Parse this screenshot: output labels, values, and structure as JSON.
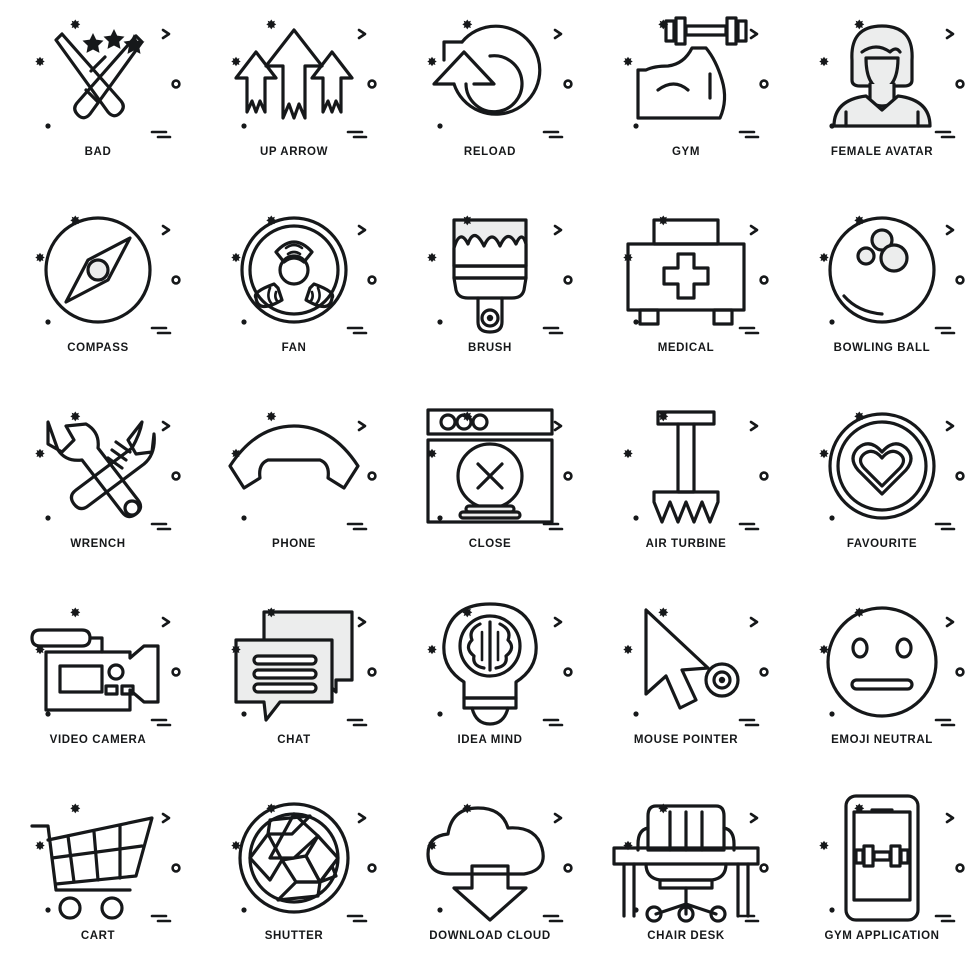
{
  "sheet": {
    "title": "Icon Set Sheet",
    "columns": 5,
    "rows": 5,
    "style": "line art / outline icons",
    "stroke_color": "#16181a",
    "fill_color": "#eceded",
    "background_color": "#ffffff"
  },
  "icons": [
    {
      "id": "bad",
      "label": "BAD",
      "glyph": "crossed-cricket-bats-with-stars"
    },
    {
      "id": "up-arrow",
      "label": "UP ARROW",
      "glyph": "three-upward-arrows"
    },
    {
      "id": "reload",
      "label": "RELOAD",
      "glyph": "circular-refresh-arrow"
    },
    {
      "id": "gym",
      "label": "GYM",
      "glyph": "flexed-arm-with-dumbbell"
    },
    {
      "id": "female-avatar",
      "label": "FEMALE AVATAR",
      "glyph": "woman-bust-portrait"
    },
    {
      "id": "compass",
      "label": "COMPASS",
      "glyph": "compass-needle-in-circle"
    },
    {
      "id": "fan",
      "label": "FAN",
      "glyph": "three-blade-fan-in-circle"
    },
    {
      "id": "brush",
      "label": "BRUSH",
      "glyph": "paint-brush-with-paint"
    },
    {
      "id": "medical",
      "label": "MEDICAL",
      "glyph": "first-aid-kit-with-cross"
    },
    {
      "id": "bowling-ball",
      "label": "BOWLING BALL",
      "glyph": "bowling-ball-three-holes"
    },
    {
      "id": "wrench",
      "label": "WRENCH",
      "glyph": "crossed-wrenches"
    },
    {
      "id": "phone",
      "label": "PHONE",
      "glyph": "telephone-handset"
    },
    {
      "id": "close",
      "label": "CLOSE",
      "glyph": "browser-window-with-x"
    },
    {
      "id": "air-turbine",
      "label": "AIR TURBINE",
      "glyph": "turbine-post-with-blades"
    },
    {
      "id": "favourite",
      "label": "FAVOURITE",
      "glyph": "heart-in-circle"
    },
    {
      "id": "video-camera",
      "label": "VIDEO CAMERA",
      "glyph": "shoulder-video-camera"
    },
    {
      "id": "chat",
      "label": "CHAT",
      "glyph": "two-speech-bubbles-with-lines"
    },
    {
      "id": "idea-mind",
      "label": "IDEA MIND",
      "glyph": "light-bulb-with-brain"
    },
    {
      "id": "mouse-pointer",
      "label": "MOUSE POINTER",
      "glyph": "cursor-arrow-with-target"
    },
    {
      "id": "emoji-neutral",
      "label": "EMOJI NEUTRAL",
      "glyph": "neutral-face-emoji"
    },
    {
      "id": "cart",
      "label": "CART",
      "glyph": "shopping-trolley"
    },
    {
      "id": "shutter",
      "label": "SHUTTER",
      "glyph": "camera-aperture-blades"
    },
    {
      "id": "download-cloud",
      "label": "DOWNLOAD CLOUD",
      "glyph": "cloud-with-down-arrow"
    },
    {
      "id": "chair-desk",
      "label": "CHAIR DESK",
      "glyph": "office-desk-and-chair"
    },
    {
      "id": "gym-application",
      "label": "GYM APPLICATION",
      "glyph": "smartphone-with-dumbbell"
    }
  ]
}
